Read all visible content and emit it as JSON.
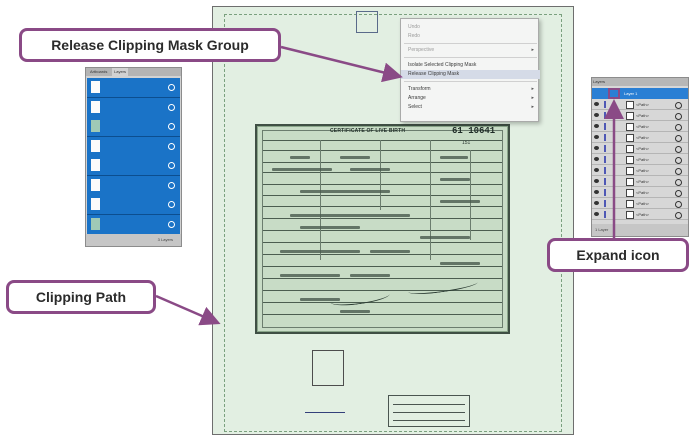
{
  "callouts": {
    "release_clipping_mask_group": "Release Clipping Mask Group",
    "expand_icon": "Expand icon",
    "clipping_path": "Clipping Path"
  },
  "context_menu": {
    "items": [
      {
        "label": "Undo",
        "disabled": true
      },
      {
        "label": "Redo",
        "disabled": true
      },
      {
        "label": "Perspective",
        "disabled": true,
        "submenu": true
      },
      {
        "label": "Isolate Selected Clipping Mask"
      },
      {
        "label": "Release Clipping Mask",
        "highlighted": true
      },
      {
        "label": "Transform",
        "submenu": true
      },
      {
        "label": "Arrange",
        "submenu": true
      },
      {
        "label": "Select",
        "submenu": true
      }
    ]
  },
  "layers_panel_left": {
    "tabs": [
      "Artboards",
      "Layers"
    ],
    "footer": "3 Layers"
  },
  "layers_panel_right": {
    "tab": "Layers",
    "selected_layer": "Layer 1",
    "rows": [
      "<Path>",
      "<Path>",
      "<Path>",
      "<Path>",
      "<Path>",
      "<Path>",
      "<Path>",
      "<Path>",
      "<Path>",
      "<Path>",
      "<Path>"
    ],
    "footer": "1 Layer"
  },
  "certificate": {
    "title": "CERTIFICATE OF LIVE BIRTH",
    "number": "61 10641",
    "sub": "151"
  },
  "colors": {
    "callout_border": "#8a4a86",
    "arrow": "#8a4a86",
    "layer_highlight": "#1a73c7",
    "artboard_bg": "#e2efe2"
  }
}
